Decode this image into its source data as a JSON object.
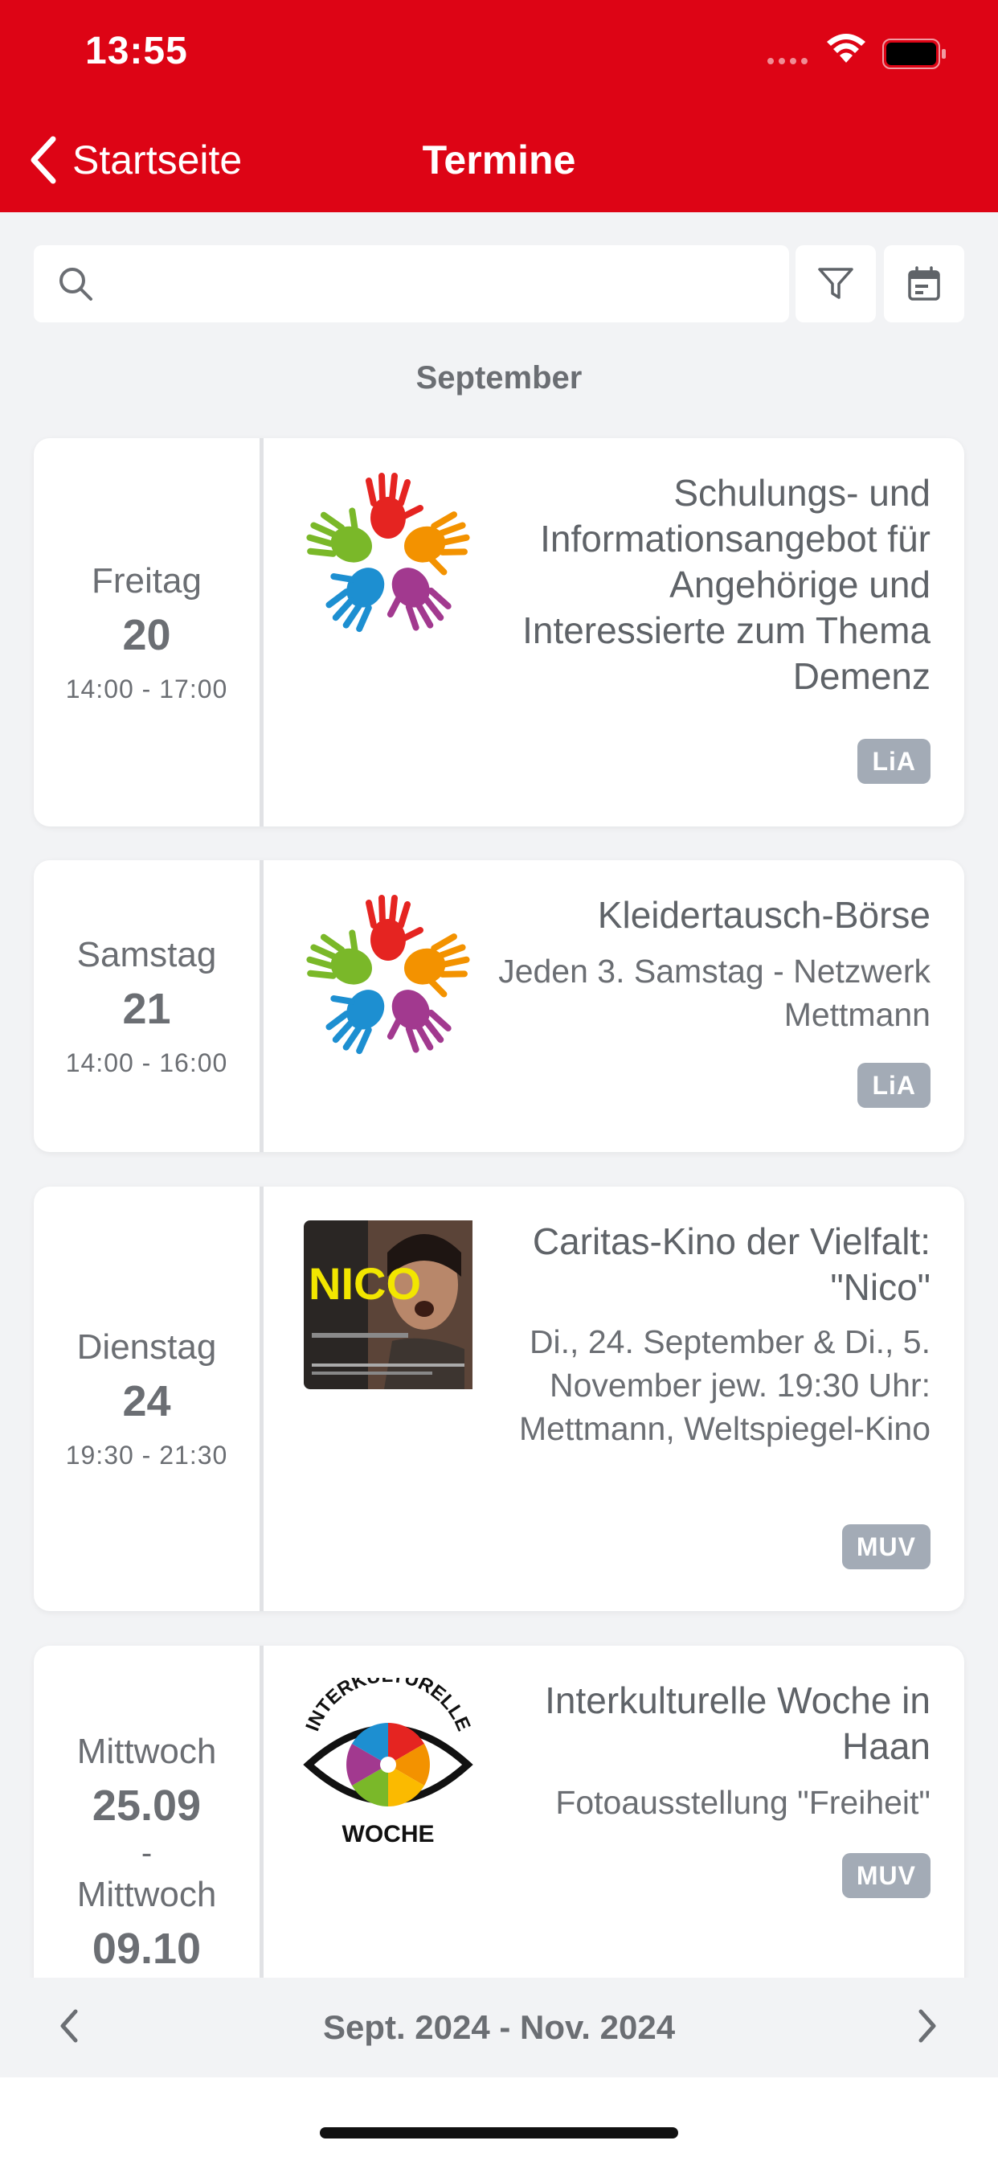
{
  "status_bar": {
    "time": "13:55"
  },
  "nav": {
    "back_label": "Startseite",
    "title": "Termine"
  },
  "search": {
    "placeholder": ""
  },
  "month": "September",
  "events": [
    {
      "weekday": "Freitag",
      "day": "20",
      "time": "14:00 - 17:00",
      "title": "Schulungs- und Informationsangebot für Angehörige und Interessierte zum Thema Demenz",
      "subtitle": "",
      "badge": "LiA",
      "thumb": "colorful-hands-logo"
    },
    {
      "weekday": "Samstag",
      "day": "21",
      "time": "14:00 - 16:00",
      "title": "Kleidertausch-Börse",
      "subtitle": "Jeden 3. Samstag - Netzwerk Mettmann",
      "badge": "LiA",
      "thumb": "colorful-hands-logo"
    },
    {
      "weekday": "Dienstag",
      "day": "24",
      "time": "19:30 - 21:30",
      "title": "Caritas-Kino der Vielfalt: \"Nico\"",
      "subtitle": "Di., 24. September & Di., 5. November jew. 19:30 Uhr: Mettmann, Weltspiegel-Kino",
      "badge": "MUV",
      "thumb": "nico-movie-poster",
      "poster_title": "NICO"
    },
    {
      "weekday": "Mittwoch",
      "day": "25.09",
      "separator": "-",
      "weekday_end": "Mittwoch",
      "day_end": "09.10",
      "title": "Interkulturelle Woche in Haan",
      "subtitle": "Fotoausstellung \"Freiheit\"",
      "badge": "MUV",
      "thumb": "interkulturelle-woche-logo",
      "logo_text_top": "INTERKULTURELLE",
      "logo_text_bottom": "WOCHE"
    }
  ],
  "footer": {
    "range": "Sept. 2024 - Nov. 2024"
  },
  "colors": {
    "header_red": "#dd0415",
    "badge_gray": "#a3abb6",
    "text_gray": "#6b6e73"
  }
}
